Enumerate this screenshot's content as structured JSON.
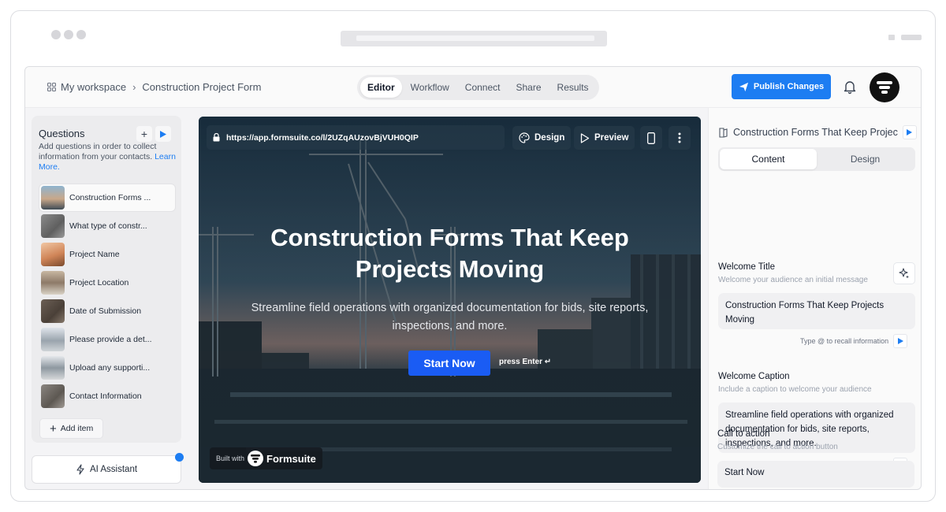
{
  "breadcrumb": {
    "workspace": "My workspace",
    "form": "Construction Project Form"
  },
  "nav_tabs": [
    "Editor",
    "Workflow",
    "Connect",
    "Share",
    "Results"
  ],
  "publish_label": "Publish Changes",
  "questions_panel": {
    "title": "Questions",
    "description": "Add questions in order to collect information from your contacts.",
    "learn_more": "Learn More.",
    "items": [
      "Construction Forms ...",
      "What type of constr...",
      "Project Name",
      "Project Location",
      "Date of Submission",
      "Please provide a det...",
      "Upload any supporti...",
      "Contact Information"
    ],
    "add_item": "Add item"
  },
  "ai_assistant": "AI Assistant",
  "preview": {
    "url": "https://app.formsuite.co/l/2UZqAUzovBjVUH0QIP",
    "design_btn": "Design",
    "preview_btn": "Preview",
    "title": "Construction Forms That Keep Projects Moving",
    "subtitle": "Streamline field operations with organized documentation for bids, site reports, inspections, and more.",
    "cta": "Start Now",
    "press_enter": "press Enter ↵",
    "built_with": "Built with",
    "brand": "Formsuite"
  },
  "settings_panel": {
    "title": "Construction Forms That Keep Projec",
    "tabs": [
      "Content",
      "Design"
    ],
    "welcome_title_label": "Welcome Title",
    "welcome_title_hint": "Welcome your audience an initial message",
    "welcome_title_value": "Construction Forms That Keep Projects Moving",
    "recall_hint": "Type @ to recall information",
    "welcome_caption_label": "Welcome Caption",
    "welcome_caption_hint": "Include a caption to welcome your audience",
    "welcome_caption_value": "Streamline field operations with organized documentation for bids, site reports, inspections, and more.",
    "cta_label": "Call to action",
    "cta_hint": "Customize the call to action button",
    "cta_value": "Start Now"
  },
  "colors": {
    "accent": "#1d7df2",
    "cta": "#1a5cf4"
  }
}
